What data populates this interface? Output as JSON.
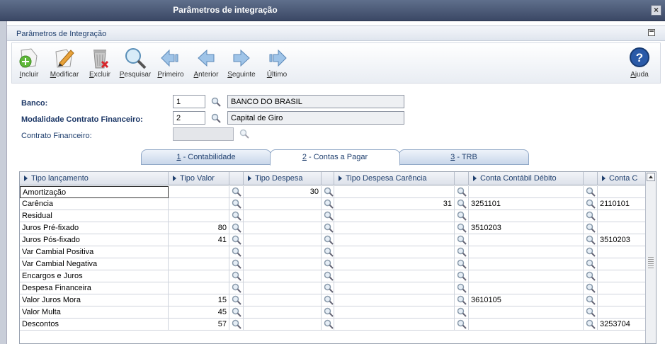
{
  "window": {
    "title": "Parâmetros de integração",
    "close": "×"
  },
  "panel": {
    "title": "Parâmetros de Integração"
  },
  "toolbar": {
    "incluir": "Incluir",
    "modificar": "Modificar",
    "excluir": "Excluir",
    "pesquisar": "Pesquisar",
    "primeiro": "Primeiro",
    "anterior": "Anterior",
    "seguinte": "Seguinte",
    "ultimo": "Último",
    "ajuda": "Ajuda"
  },
  "form": {
    "banco": {
      "label": "Banco:",
      "code": "1",
      "name": "BANCO DO BRASIL"
    },
    "modalidade": {
      "label": "Modalidade Contrato Financeiro:",
      "code": "2",
      "name": "Capital de Giro"
    },
    "contrato": {
      "label": "Contrato Financeiro:",
      "code": ""
    }
  },
  "tabs": [
    {
      "num": "1",
      "label": " - Contabilidade"
    },
    {
      "num": "2",
      "label": " - Contas a Pagar"
    },
    {
      "num": "3",
      "label": " - TRB"
    }
  ],
  "grid": {
    "columns": [
      "Tipo lançamento",
      "Tipo Valor",
      "Tipo Despesa",
      "Tipo Despesa Carência",
      "Conta Contábil Débito",
      "Conta C"
    ],
    "rows": [
      {
        "tipo": "Amortização",
        "valor": "",
        "despesa": "30",
        "carencia": "",
        "debito": "",
        "credito": ""
      },
      {
        "tipo": "Carência",
        "valor": "",
        "despesa": "",
        "carencia": "31",
        "debito": "3251101",
        "credito": "2110101"
      },
      {
        "tipo": "Residual",
        "valor": "",
        "despesa": "",
        "carencia": "",
        "debito": "",
        "credito": ""
      },
      {
        "tipo": "Juros Pré-fixado",
        "valor": "80",
        "despesa": "",
        "carencia": "",
        "debito": "3510203",
        "credito": ""
      },
      {
        "tipo": "Juros Pós-fixado",
        "valor": "41",
        "despesa": "",
        "carencia": "",
        "debito": "",
        "credito": "3510203"
      },
      {
        "tipo": "Var Cambial Positiva",
        "valor": "",
        "despesa": "",
        "carencia": "",
        "debito": "",
        "credito": ""
      },
      {
        "tipo": "Var Cambial Negativa",
        "valor": "",
        "despesa": "",
        "carencia": "",
        "debito": "",
        "credito": ""
      },
      {
        "tipo": "Encargos e Juros",
        "valor": "",
        "despesa": "",
        "carencia": "",
        "debito": "",
        "credito": ""
      },
      {
        "tipo": "Despesa Financeira",
        "valor": "",
        "despesa": "",
        "carencia": "",
        "debito": "",
        "credito": ""
      },
      {
        "tipo": "Valor Juros Mora",
        "valor": "15",
        "despesa": "",
        "carencia": "",
        "debito": "3610105",
        "credito": ""
      },
      {
        "tipo": "Valor Multa",
        "valor": "45",
        "despesa": "",
        "carencia": "",
        "debito": "",
        "credito": ""
      },
      {
        "tipo": "Descontos",
        "valor": "57",
        "despesa": "",
        "carencia": "",
        "debito": "",
        "credito": "3253704"
      }
    ]
  }
}
